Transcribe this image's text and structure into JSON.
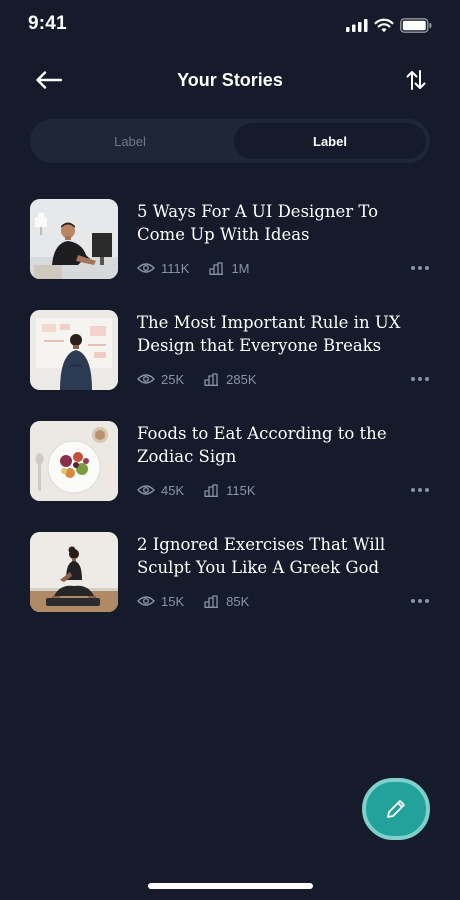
{
  "status": {
    "time": "9:41",
    "icons": [
      "cellular-icon",
      "wifi-icon",
      "battery-icon"
    ]
  },
  "header": {
    "title": "Your Stories",
    "back_icon": "arrow-left-icon",
    "sort_icon": "sort-arrows-icon"
  },
  "tabs": [
    {
      "label": "Label",
      "selected": false
    },
    {
      "label": "Label",
      "selected": true
    }
  ],
  "stories": [
    {
      "title": "5 Ways For A UI Designer To Come Up With Ideas",
      "views": "111K",
      "reads": "1M",
      "thumbnail": "designer-at-desk"
    },
    {
      "title": "The Most Important Rule in UX Design that Everyone Breaks",
      "views": "25K",
      "reads": "285K",
      "thumbnail": "man-at-whiteboard"
    },
    {
      "title": "Foods to Eat According to the Zodiac Sign",
      "views": "45K",
      "reads": "115K",
      "thumbnail": "food-plate"
    },
    {
      "title": "2 Ignored Exercises That Will Sculpt You Like A Greek God",
      "views": "15K",
      "reads": "85K",
      "thumbnail": "yoga-woman"
    }
  ],
  "fab": {
    "icon": "pencil-icon"
  },
  "colors": {
    "background": "#151b2a",
    "segment_track": "#1f2736",
    "muted_text": "#8a93a3",
    "fab": "#23a29b",
    "fab_ring": "#7fd0cb"
  }
}
